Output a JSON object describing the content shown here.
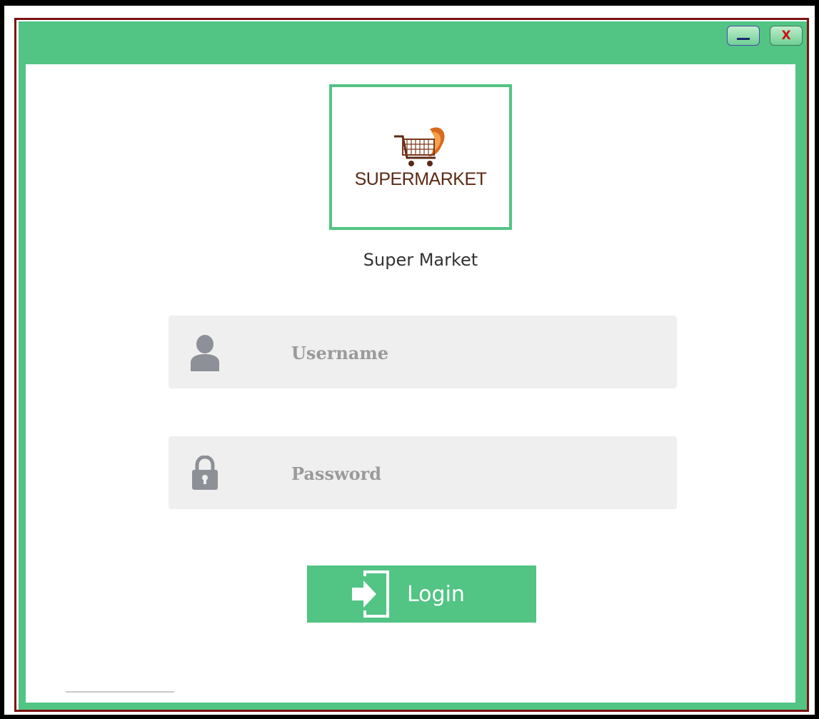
{
  "window": {
    "minimize_icon": "minimize-icon",
    "close_label": "X",
    "accent_color": "#52c484",
    "close_color": "#d0101a"
  },
  "logo": {
    "text": "SUPERMARKET",
    "icon": "shopping-cart-icon",
    "text_color": "#5b2a16"
  },
  "app_title": "Super Market",
  "login_form": {
    "username": {
      "placeholder": "Username",
      "value": "",
      "icon": "user-icon"
    },
    "password": {
      "placeholder": "Password",
      "value": "",
      "icon": "lock-icon"
    },
    "login_button": {
      "label": "Login",
      "icon": "login-icon"
    }
  }
}
